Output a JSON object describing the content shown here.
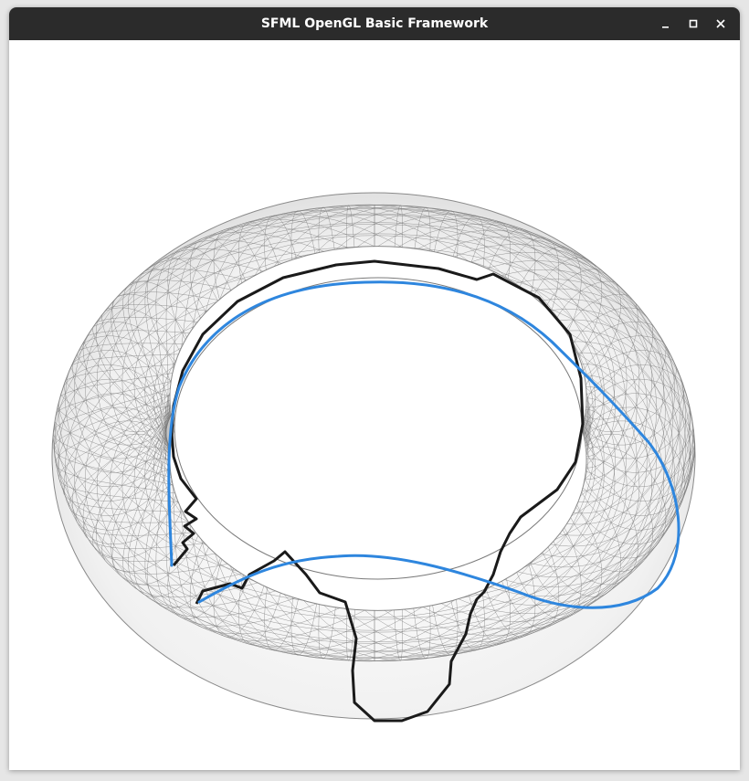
{
  "window": {
    "title": "SFML OpenGL Basic Framework",
    "controls": [
      {
        "name": "minimize",
        "icon": "minimize-icon"
      },
      {
        "name": "maximize",
        "icon": "maximize-icon"
      },
      {
        "name": "close",
        "icon": "close-icon"
      }
    ]
  },
  "scene": {
    "object": "torus-mesh",
    "mesh_color": "#f0f0f0",
    "wire_color": "#7a7a7a",
    "paths": [
      {
        "name": "geodesic-path",
        "color": "#2e86de"
      },
      {
        "name": "mesh-edge-path",
        "color": "#1a1a1a"
      }
    ]
  }
}
